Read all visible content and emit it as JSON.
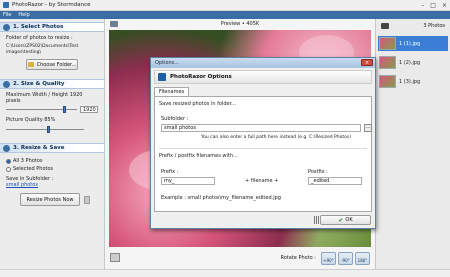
{
  "window": {
    "title": "PhotoRazor - by Stormdance",
    "controls": [
      "–",
      "□",
      "×"
    ]
  },
  "menu": [
    "File",
    "Help"
  ],
  "left_panel": {
    "step1": {
      "label": "1. Select Photos",
      "folder_label": "Folder of photos to resize :",
      "folder_path": "C:\\Users\\ZPS02\\Documents\\Test images\\testing\\",
      "choose_button": "Choose Folder..."
    },
    "step2": {
      "label": "2. Size & Quality",
      "max_size_label": "Maximum Width / Height 1920 pixels",
      "max_size_value": "1920",
      "max_size_fraction": 0.83,
      "quality_label": "Picture Quality 85%",
      "quality_fraction": 0.55
    },
    "step3": {
      "label": "3. Resize & Save",
      "radio_all": "All 3 Photos",
      "radio_selected": "Selected Photos",
      "subfolder_label": "Save in Subfolder :",
      "subfolder_link": "small photos",
      "resize_button": "Resize Photos Now"
    }
  },
  "preview": {
    "label": "Preview • 405K"
  },
  "rotate": {
    "label": "Rotate Photo :",
    "buttons": [
      "+90°",
      "-90°",
      "180°"
    ]
  },
  "right_panel": {
    "count_label": "3 Photos",
    "items": [
      "1 (1).jpg",
      "1 (2).jpg",
      "1 (3).jpg"
    ]
  },
  "dialog": {
    "title": "Options...",
    "close": "×",
    "banner": "PhotoRazor Options",
    "tab": "Filenames",
    "save_in_label": "Save resized photos in folder...",
    "subfolder_label": "Subfolder :",
    "subfolder_value": "small photos",
    "browse_button": "...",
    "hint": "You can also enter a full path here instead (e.g. C:\\Resized Photos)",
    "prefix_section": "Prefix / postfix filenames with...",
    "prefix_label": "Prefix :",
    "prefix_value": "my_",
    "plus1": "+ filename +",
    "postfix_label": "Postfix :",
    "postfix_value": "_edited",
    "example": "Example : small photos\\my_filename_edited.jpg",
    "ok_button": "OK"
  }
}
